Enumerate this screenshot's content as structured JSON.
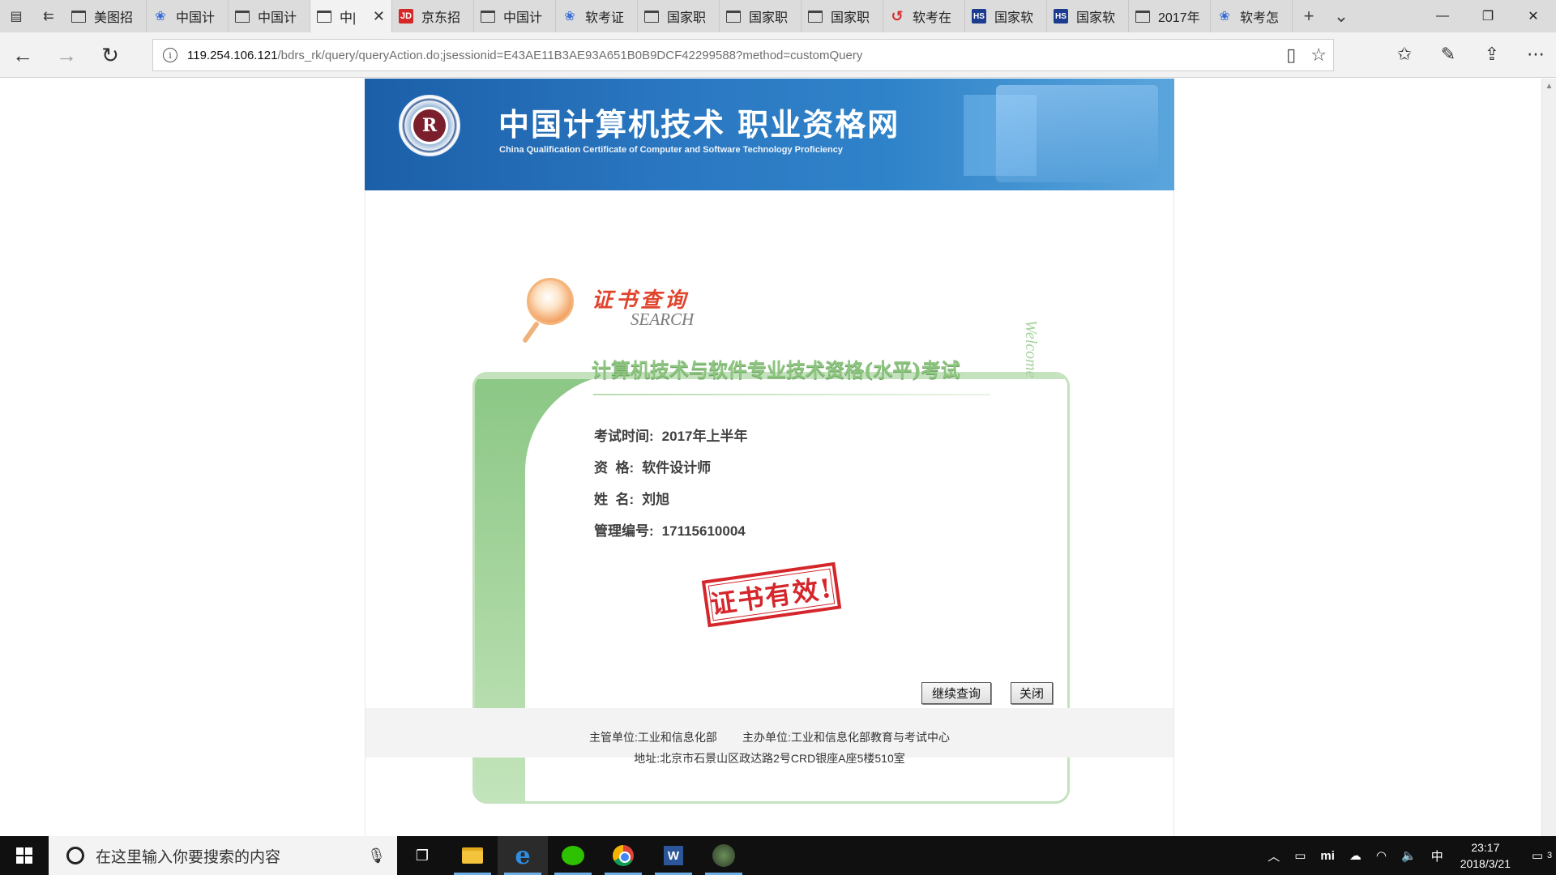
{
  "tabs": [
    {
      "label": "美图招",
      "favicon": "page-icon"
    },
    {
      "label": "中国计",
      "favicon": "paw-icon"
    },
    {
      "label": "中国计",
      "favicon": "page-icon"
    },
    {
      "label": "中|",
      "favicon": "page-icon",
      "active": true
    },
    {
      "label": "京东招",
      "favicon": "jd-icon"
    },
    {
      "label": "中国计",
      "favicon": "page-icon"
    },
    {
      "label": "软考证",
      "favicon": "paw-icon"
    },
    {
      "label": "国家职",
      "favicon": "page-icon"
    },
    {
      "label": "国家职",
      "favicon": "page-icon"
    },
    {
      "label": "国家职",
      "favicon": "page-icon"
    },
    {
      "label": "软考在",
      "favicon": "swirl-icon"
    },
    {
      "label": "国家软",
      "favicon": "hs-icon"
    },
    {
      "label": "国家软",
      "favicon": "hs-icon"
    },
    {
      "label": "2017年",
      "favicon": "page-icon"
    },
    {
      "label": "软考怎",
      "favicon": "paw-icon"
    }
  ],
  "favicon_text": {
    "jd": "JD",
    "hs": "HS"
  },
  "address": {
    "host": "119.254.106.121",
    "path": "/bdrs_rk/query/queryAction.do;jsessionid=E43AE11B3AE93A651B0B9DCF42299588?method=customQuery"
  },
  "banner": {
    "title": "中国计算机技术 职业资格网",
    "subtitle": "China Qualification Certificate of Computer and Software Technology Proficiency",
    "seal_letter": "R"
  },
  "card": {
    "search_cn": "证书查询",
    "search_en": "SEARCH",
    "welcome": "Welcome",
    "exam_title": "计算机技术与软件专业技术资格(水平)考试",
    "fields": [
      {
        "label": "考试时间:",
        "value": "2017年上半年"
      },
      {
        "label": "资  格:",
        "value": "软件设计师"
      },
      {
        "label": "姓  名:",
        "value": "刘旭"
      },
      {
        "label": "管理编号:",
        "value": "17115610004"
      }
    ],
    "stamp": "证书有效!",
    "continue_button": "继续查询",
    "close_button": "关闭"
  },
  "footer": {
    "line1": "主管单位:工业和信息化部        主办单位:工业和信息化部教育与考试中心",
    "line2": "地址:北京市石景山区政达路2号CRD银座A座5楼510室"
  },
  "taskbar": {
    "search_placeholder": "在这里输入你要搜索的内容",
    "ime": "中",
    "time": "23:17",
    "date": "2018/3/21",
    "notifications": "3"
  }
}
